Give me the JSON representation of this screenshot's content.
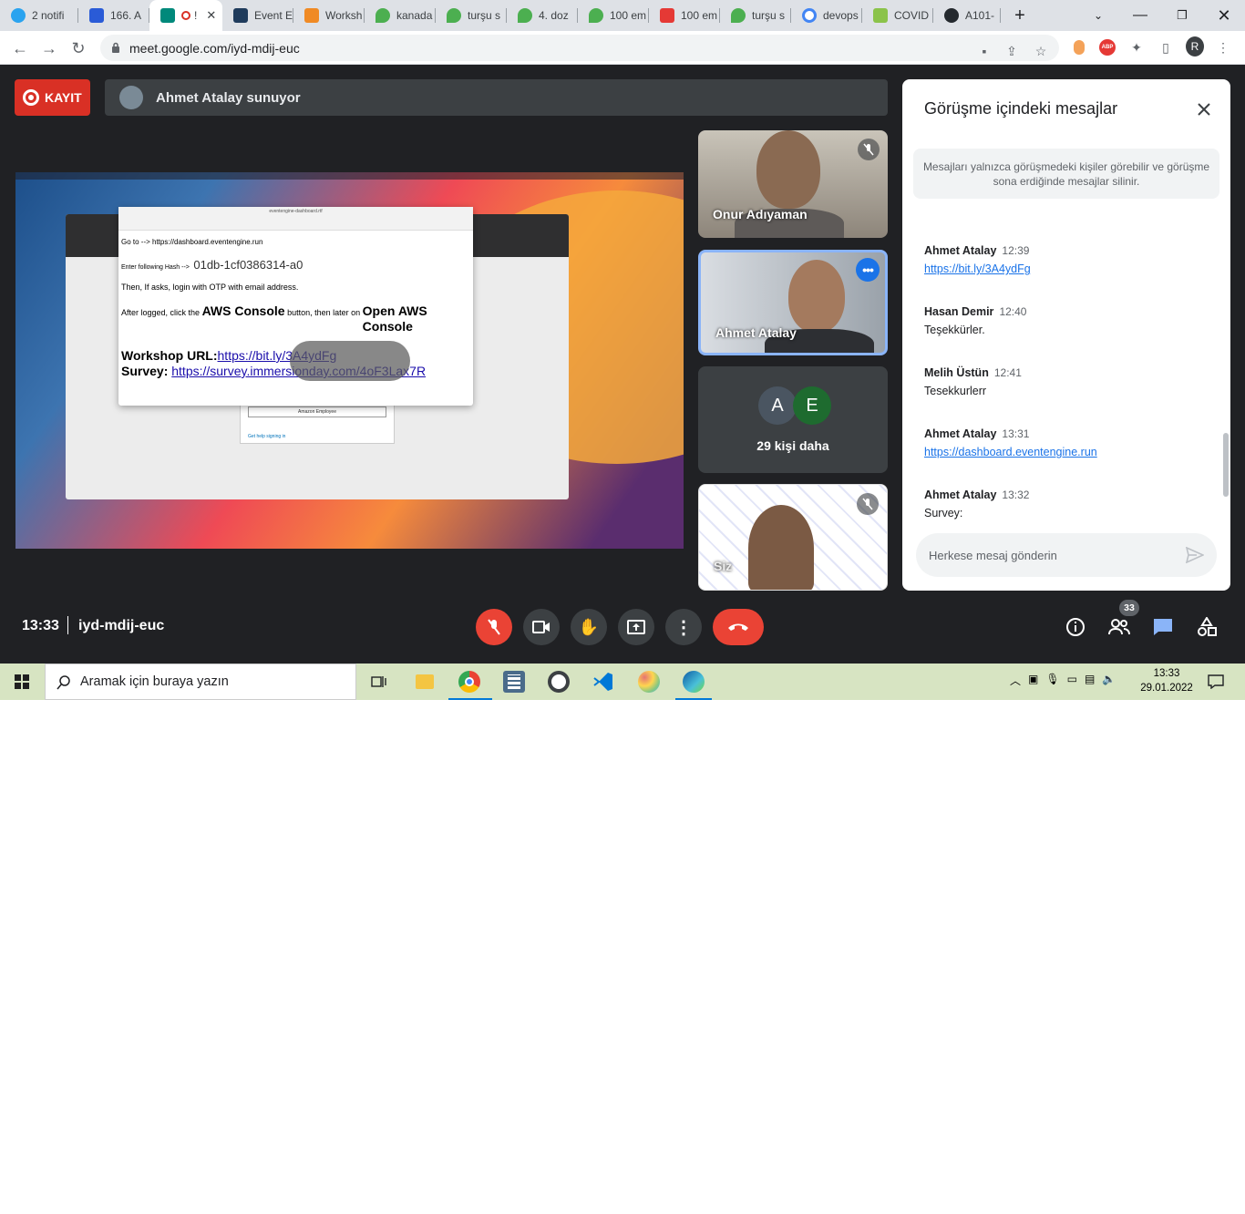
{
  "browser": {
    "tabs": [
      {
        "label": "2 notifi",
        "color": "#2aa3ef"
      },
      {
        "label": "166. A",
        "color": "#2a5bd7"
      },
      {
        "label": "!",
        "color": "#00897b"
      },
      {
        "label": "Event E",
        "color": "#1f3b5c"
      },
      {
        "label": "Worksh",
        "color": "#f08a24"
      },
      {
        "label": "kanada",
        "color": "#4caf50"
      },
      {
        "label": "turşu s",
        "color": "#4caf50"
      },
      {
        "label": "4. doz",
        "color": "#4caf50"
      },
      {
        "label": "100 em",
        "color": "#4caf50"
      },
      {
        "label": "100 em",
        "color": "#e53935"
      },
      {
        "label": "turşu s",
        "color": "#4caf50"
      },
      {
        "label": "devops",
        "color": "#4285f4"
      },
      {
        "label": "COVID",
        "color": "#8bc34a"
      },
      {
        "label": "A101-",
        "color": "#24292e"
      }
    ],
    "url": "meet.google.com/iyd-mdij-euc",
    "profile_initial": "R",
    "abp_label": "ABP"
  },
  "meet": {
    "record_label": "KAYIT",
    "presenter_text": "Ahmet Atalay sunuyor",
    "time": "13:33",
    "meeting_code": "iyd-mdij-euc",
    "people_count": "33",
    "participants": [
      {
        "name": "Onur Adıyaman"
      },
      {
        "name": "Ahmet Atalay"
      },
      {
        "name": "29 kişi daha",
        "initials": [
          "A",
          "E"
        ]
      },
      {
        "name": "Siz"
      }
    ]
  },
  "shared_screen": {
    "editor_title": "eventengine-dashboard.rtf",
    "line_goto": "Go to --> https://dashboard.eventengine.run",
    "line_hash_label": "Enter following Hash -->",
    "line_hash_value": "01db-1cf0386314-a0",
    "line_then": "Then, If asks, login with OTP with email address.",
    "line_after_1": "After logged, click the",
    "line_aws": "AWS Console",
    "line_after_2": "button, then later on",
    "line_open": "Open AWS Console",
    "workshop_label": "Workshop URL:",
    "workshop_url": "https://bit.ly/3A4ydFg",
    "survey_label": "Survey:",
    "survey_url": "https://survey.immersionday.com/4oF3Lax7R",
    "login_help": "Get help signing in",
    "amazon_employee": "Amazon Employee"
  },
  "chat": {
    "title": "Görüşme içindeki mesajlar",
    "notice": "Mesajları yalnızca görüşmedeki kişiler görebilir ve görüşme sona erdiğinde mesajlar silinir.",
    "messages": [
      {
        "author": "Ahmet Atalay",
        "time": "12:39",
        "text": "https://bit.ly/3A4ydFg",
        "link": true
      },
      {
        "author": "Hasan Demir",
        "time": "12:40",
        "text": "Teşekkürler.",
        "link": false
      },
      {
        "author": "Melih Üstün",
        "time": "12:41",
        "text": "Tesekkurlerr",
        "link": false
      },
      {
        "author": "Ahmet Atalay",
        "time": "13:31",
        "text": "https://dashboard.eventengine.run",
        "link": true
      },
      {
        "author": "Ahmet Atalay",
        "time": "13:32",
        "text": "Survey:",
        "link": false
      }
    ],
    "input_placeholder": "Herkese mesaj gönderin"
  },
  "taskbar": {
    "search_placeholder": "Aramak için buraya yazın",
    "time": "13:33",
    "date": "29.01.2022"
  },
  "colors": {
    "meet_bg": "#202124",
    "end_call": "#ea4335",
    "mic_off": "#ea4335",
    "chat_active": "#8ab4f8",
    "link": "#1a73e8"
  }
}
